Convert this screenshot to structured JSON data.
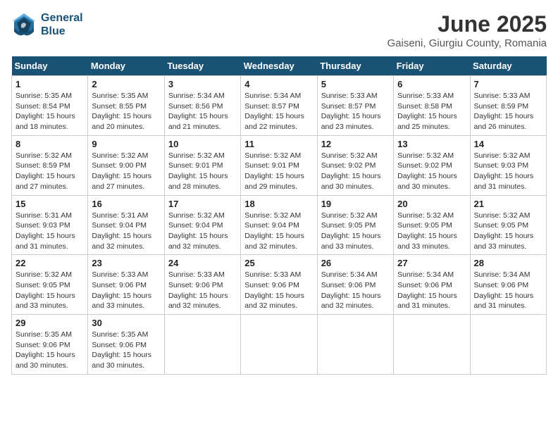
{
  "header": {
    "logo_line1": "General",
    "logo_line2": "Blue",
    "month": "June 2025",
    "location": "Gaiseni, Giurgiu County, Romania"
  },
  "weekdays": [
    "Sunday",
    "Monday",
    "Tuesday",
    "Wednesday",
    "Thursday",
    "Friday",
    "Saturday"
  ],
  "weeks": [
    [
      {
        "day": "1",
        "sunrise": "5:35 AM",
        "sunset": "8:54 PM",
        "daylight": "15 hours and 18 minutes."
      },
      {
        "day": "2",
        "sunrise": "5:35 AM",
        "sunset": "8:55 PM",
        "daylight": "15 hours and 20 minutes."
      },
      {
        "day": "3",
        "sunrise": "5:34 AM",
        "sunset": "8:56 PM",
        "daylight": "15 hours and 21 minutes."
      },
      {
        "day": "4",
        "sunrise": "5:34 AM",
        "sunset": "8:57 PM",
        "daylight": "15 hours and 22 minutes."
      },
      {
        "day": "5",
        "sunrise": "5:33 AM",
        "sunset": "8:57 PM",
        "daylight": "15 hours and 23 minutes."
      },
      {
        "day": "6",
        "sunrise": "5:33 AM",
        "sunset": "8:58 PM",
        "daylight": "15 hours and 25 minutes."
      },
      {
        "day": "7",
        "sunrise": "5:33 AM",
        "sunset": "8:59 PM",
        "daylight": "15 hours and 26 minutes."
      }
    ],
    [
      {
        "day": "8",
        "sunrise": "5:32 AM",
        "sunset": "8:59 PM",
        "daylight": "15 hours and 27 minutes."
      },
      {
        "day": "9",
        "sunrise": "5:32 AM",
        "sunset": "9:00 PM",
        "daylight": "15 hours and 27 minutes."
      },
      {
        "day": "10",
        "sunrise": "5:32 AM",
        "sunset": "9:01 PM",
        "daylight": "15 hours and 28 minutes."
      },
      {
        "day": "11",
        "sunrise": "5:32 AM",
        "sunset": "9:01 PM",
        "daylight": "15 hours and 29 minutes."
      },
      {
        "day": "12",
        "sunrise": "5:32 AM",
        "sunset": "9:02 PM",
        "daylight": "15 hours and 30 minutes."
      },
      {
        "day": "13",
        "sunrise": "5:32 AM",
        "sunset": "9:02 PM",
        "daylight": "15 hours and 30 minutes."
      },
      {
        "day": "14",
        "sunrise": "5:32 AM",
        "sunset": "9:03 PM",
        "daylight": "15 hours and 31 minutes."
      }
    ],
    [
      {
        "day": "15",
        "sunrise": "5:31 AM",
        "sunset": "9:03 PM",
        "daylight": "15 hours and 31 minutes."
      },
      {
        "day": "16",
        "sunrise": "5:31 AM",
        "sunset": "9:04 PM",
        "daylight": "15 hours and 32 minutes."
      },
      {
        "day": "17",
        "sunrise": "5:32 AM",
        "sunset": "9:04 PM",
        "daylight": "15 hours and 32 minutes."
      },
      {
        "day": "18",
        "sunrise": "5:32 AM",
        "sunset": "9:04 PM",
        "daylight": "15 hours and 32 minutes."
      },
      {
        "day": "19",
        "sunrise": "5:32 AM",
        "sunset": "9:05 PM",
        "daylight": "15 hours and 33 minutes."
      },
      {
        "day": "20",
        "sunrise": "5:32 AM",
        "sunset": "9:05 PM",
        "daylight": "15 hours and 33 minutes."
      },
      {
        "day": "21",
        "sunrise": "5:32 AM",
        "sunset": "9:05 PM",
        "daylight": "15 hours and 33 minutes."
      }
    ],
    [
      {
        "day": "22",
        "sunrise": "5:32 AM",
        "sunset": "9:05 PM",
        "daylight": "15 hours and 33 minutes."
      },
      {
        "day": "23",
        "sunrise": "5:33 AM",
        "sunset": "9:06 PM",
        "daylight": "15 hours and 33 minutes."
      },
      {
        "day": "24",
        "sunrise": "5:33 AM",
        "sunset": "9:06 PM",
        "daylight": "15 hours and 32 minutes."
      },
      {
        "day": "25",
        "sunrise": "5:33 AM",
        "sunset": "9:06 PM",
        "daylight": "15 hours and 32 minutes."
      },
      {
        "day": "26",
        "sunrise": "5:34 AM",
        "sunset": "9:06 PM",
        "daylight": "15 hours and 32 minutes."
      },
      {
        "day": "27",
        "sunrise": "5:34 AM",
        "sunset": "9:06 PM",
        "daylight": "15 hours and 31 minutes."
      },
      {
        "day": "28",
        "sunrise": "5:34 AM",
        "sunset": "9:06 PM",
        "daylight": "15 hours and 31 minutes."
      }
    ],
    [
      {
        "day": "29",
        "sunrise": "5:35 AM",
        "sunset": "9:06 PM",
        "daylight": "15 hours and 30 minutes."
      },
      {
        "day": "30",
        "sunrise": "5:35 AM",
        "sunset": "9:06 PM",
        "daylight": "15 hours and 30 minutes."
      },
      null,
      null,
      null,
      null,
      null
    ]
  ]
}
